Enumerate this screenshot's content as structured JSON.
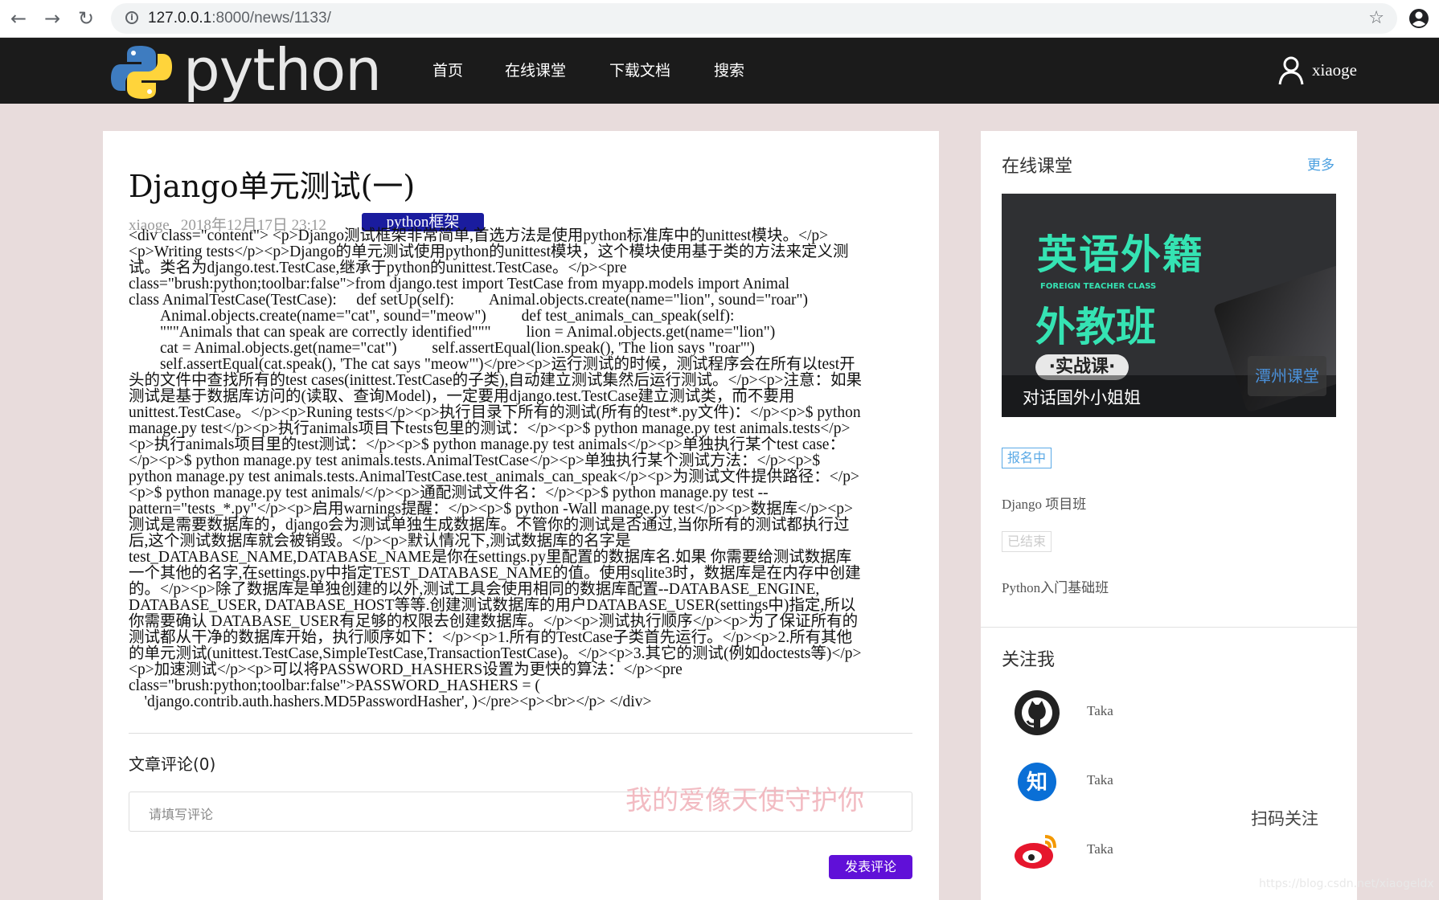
{
  "browser": {
    "url_host": "127.0.0.1",
    "url_path": ":8000/news/1133/"
  },
  "site": {
    "logo_text": "python",
    "nav": [
      "首页",
      "在线课堂",
      "下载文档",
      "搜索"
    ],
    "username": "xiaoge"
  },
  "article": {
    "title": "Django单元测试(一)",
    "author": "xiaoge",
    "date": "2018年12月17日 23:12",
    "tag": "python框架",
    "content": "<div class=\"content\"> <p>Django测试框架非常简单,首选方法是使用python标准库中的unittest模块。</p>\n<p>Writing tests</p><p>Django的单元测试使用python的unittest模块，这个模块使用基于类的方法来定义测\n试。类名为django.test.TestCase,继承于python的unittest.TestCase。</p><pre\nclass=\"brush:python;toolbar:false\">from django.test import TestCase from myapp.models import Animal\nclass AnimalTestCase(TestCase):     def setUp(self):         Animal.objects.create(name=\"lion\", sound=\"roar\")\n        Animal.objects.create(name=\"cat\", sound=\"meow\")         def test_animals_can_speak(self):\n        \"\"\"Animals that can speak are correctly identified\"\"\"         lion = Animal.objects.get(name=\"lion\")\n        cat = Animal.objects.get(name=\"cat\")         self.assertEqual(lion.speak(), 'The lion says \"roar\"')\n        self.assertEqual(cat.speak(), 'The cat says \"meow\"')</pre><p>运行测试的时候，测试程序会在所有以test开\n头的文件中查找所有的test cases(inittest.TestCase的子类),自动建立测试集然后运行测试。</p><p>注意：如果\n测试是基于数据库访问的(读取、查询Model)，一定要用django.test.TestCase建立测试类，而不要用\nunittest.TestCase。</p><p>Runing tests</p><p>执行目录下所有的测试(所有的test*.py文件)：</p><p>$ python\nmanage.py test</p><p>执行animals项目下tests包里的测试：</p><p>$ python manage.py test animals.tests</p>\n<p>执行animals项目里的test测试：</p><p>$ python manage.py test animals</p><p>单独执行某个test case：\n</p><p>$ python manage.py test animals.tests.AnimalTestCase</p><p>单独执行某个测试方法：</p><p>$\npython manage.py test animals.tests.AnimalTestCase.test_animals_can_speak</p><p>为测试文件提供路径：</p>\n<p>$ python manage.py test animals/</p><p>通配测试文件名：</p><p>$ python manage.py test --\npattern=\"tests_*.py\"</p><p>启用warnings提醒：</p><p>$ python -Wall manage.py test</p><p>数据库</p><p>\n测试是需要数据库的，django会为测试单独生成数据库。不管你的测试是否通过,当你所有的测试都执行过\n后,这个测试数据库就会被销毁。</p><p>默认情况下,测试数据库的名字是\ntest_DATABASE_NAME,DATABASE_NAME是你在settings.py里配置的数据库名.如果 你需要给测试数据库\n一个其他的名字,在settings.py中指定TEST_DATABASE_NAME的值。使用sqlite3时，数据库是在内存中创建\n的。</p><p>除了数据库是单独创建的以外,测试工具会使用相同的数据库配置--DATABASE_ENGINE,\nDATABASE_USER, DATABASE_HOST等等.创建测试数据库的用户DATABASE_USER(settings中)指定,所以\n你需要确认 DATABASE_USER有足够的权限去创建数据库。</p><p>测试执行顺序</p><p>为了保证所有的\n测试都从干净的数据库开始，执行顺序如下：</p><p>1.所有的TestCase子类首先运行。</p><p>2.所有其他\n的单元测试(unittest.TestCase,SimpleTestCase,TransactionTestCase)。</p><p>3.其它的测试(例如doctests等)</p>\n<p>加速测试</p><p>可以将PASSWORD_HASHERS设置为更快的算法：</p><pre\nclass=\"brush:python;toolbar:false\">PASSWORD_HASHERS = (\n    'django.contrib.auth.hashers.MD5PasswordHasher', )</pre><p><br></p> </div>"
  },
  "comments": {
    "title": "文章评论(0)",
    "placeholder": "请填写评论",
    "submit_label": "发表评论",
    "watermark": "我的爱像天使守护你"
  },
  "sidebar": {
    "online_class_title": "在线课堂",
    "more_label": "更多",
    "banner": {
      "line1": "英语外籍",
      "sub": "FOREIGN TEACHER CLASS",
      "line2": "外教班",
      "pill": "·实战课·",
      "logo": "潭州课堂",
      "caption": "对话国外小姐姐"
    },
    "courses": [
      {
        "status": "报名中",
        "status_color": "#5aa9e6",
        "name": "Django 项目班"
      },
      {
        "status": "已结束",
        "status_color": "#cccccc",
        "name": "Python入门基础班"
      }
    ],
    "follow_title": "关注我",
    "follow": [
      {
        "icon": "github-icon",
        "label": "Taka"
      },
      {
        "icon": "zhihu-icon",
        "label": "Taka"
      },
      {
        "icon": "weibo-icon",
        "label": "Taka"
      }
    ],
    "scan_label": "扫码关注"
  },
  "page_watermark": "https://blog.csdn.net/xiaogeldx",
  "colors": {
    "nav_bg": "#1b1b1b",
    "page_bg": "#e8dcdc",
    "tag_bg": "#1a1c9e",
    "submit_bg": "#6010d8",
    "banner_accent": "#35e3b3"
  }
}
